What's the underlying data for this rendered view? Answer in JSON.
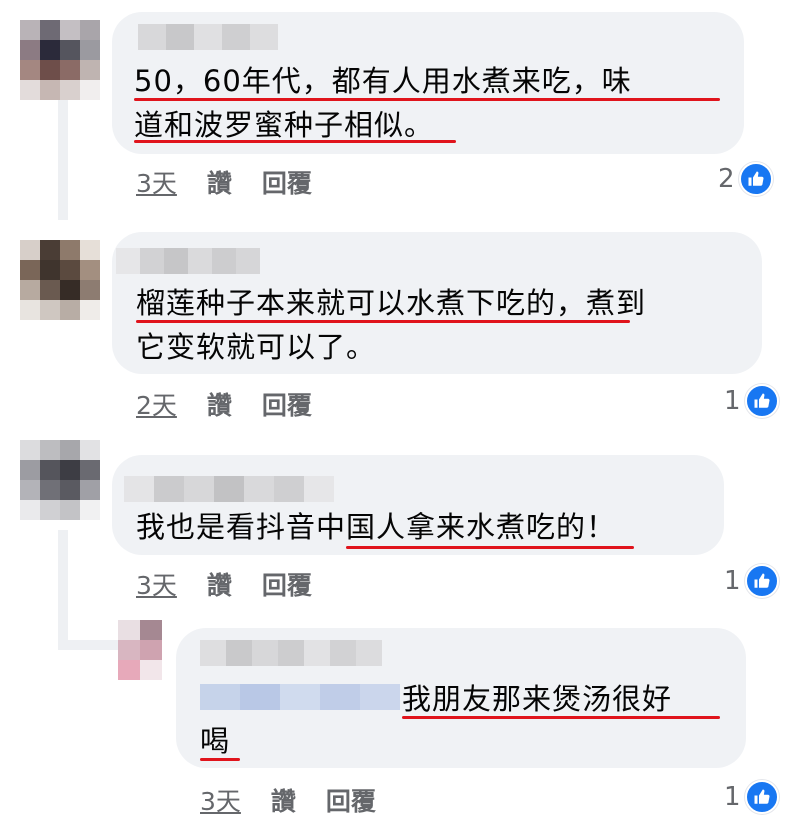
{
  "comments": [
    {
      "line1": "50，60年代，都有人用水煮来吃，味",
      "line2": "道和波罗蜜种子相似。",
      "time": "3天",
      "like_label": "讚",
      "reply_label": "回覆",
      "reaction_count": "2"
    },
    {
      "line1": "榴莲种子本来就可以水煮下吃的，煮到",
      "line2": "它变软就可以了。",
      "time": "2天",
      "like_label": "讚",
      "reply_label": "回覆",
      "reaction_count": "1"
    },
    {
      "line1": "我也是看抖音中国人拿来水煮吃的！",
      "time": "3天",
      "like_label": "讚",
      "reply_label": "回覆",
      "reaction_count": "1"
    },
    {
      "line1": "我朋友那来煲汤很好",
      "line2": "喝",
      "time": "3天",
      "like_label": "讚",
      "reply_label": "回覆",
      "reaction_count": "1"
    }
  ],
  "colors": {
    "bubble": "#f0f2f5",
    "underline": "#e0141c",
    "like": "#1877f2",
    "meta": "#65676b"
  },
  "icons": {
    "reaction": "thumbs-up-icon"
  }
}
